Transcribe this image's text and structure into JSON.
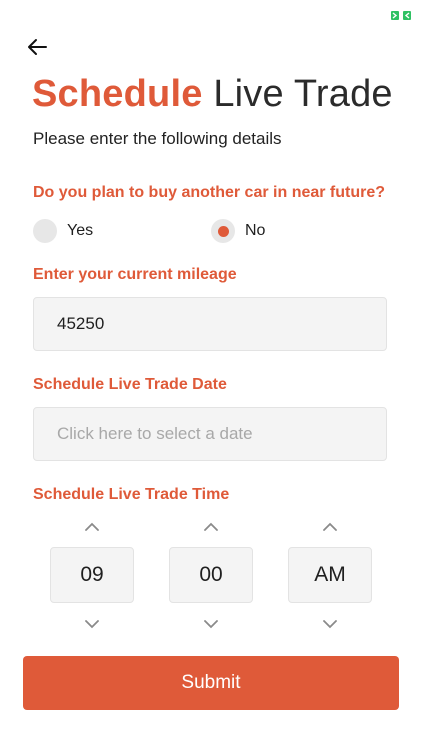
{
  "header": {
    "title_bold": "Schedule",
    "title_light": "Live Trade",
    "subtitle": "Please enter the following details"
  },
  "icons": {
    "back": "arrow-left-icon",
    "corner": "expand-icon",
    "increment": "chevron-up-icon",
    "decrement": "chevron-down-icon"
  },
  "question_buy": {
    "label": "Do you plan to buy another car in near future?",
    "options": [
      {
        "label": "Yes",
        "selected": false
      },
      {
        "label": "No",
        "selected": true
      }
    ]
  },
  "mileage": {
    "label": "Enter your current mileage",
    "value": "45250"
  },
  "date": {
    "label": "Schedule Live Trade Date",
    "placeholder": "Click here to select a date"
  },
  "time": {
    "label": "Schedule Live Trade Time",
    "hour": "09",
    "minute": "00",
    "period": "AM"
  },
  "submit_label": "Submit",
  "colors": {
    "accent": "#df5a39",
    "corner_icon": "#2fc163",
    "field_bg": "#f4f4f4"
  }
}
